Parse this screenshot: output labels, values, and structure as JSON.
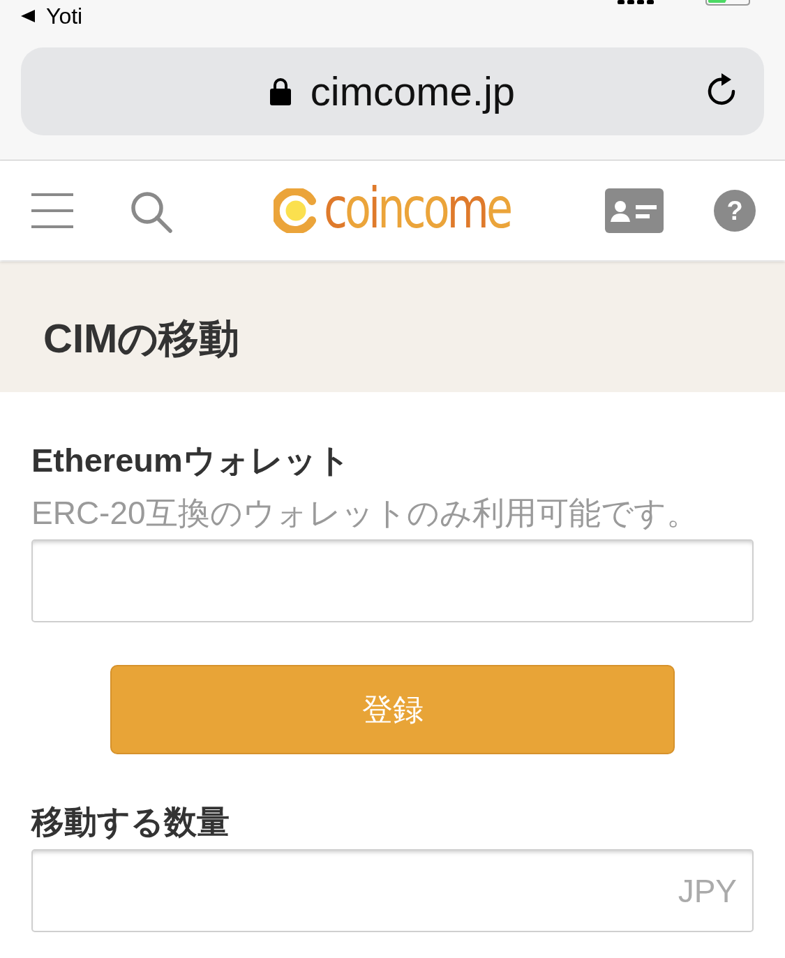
{
  "status_bar": {
    "back_label": "Yoti"
  },
  "address_bar": {
    "url": "cimcome.jp",
    "secure": true
  },
  "site_header": {
    "logo": "coincome",
    "help": "?"
  },
  "page_title": "CIMの移動",
  "wallet": {
    "label": "Ethereumウォレット",
    "hint": "ERC-20互換のウォレットのみ利用可能です。",
    "submit": "登録"
  },
  "amount": {
    "label": "移動する数量",
    "suffix": "JPY"
  }
}
